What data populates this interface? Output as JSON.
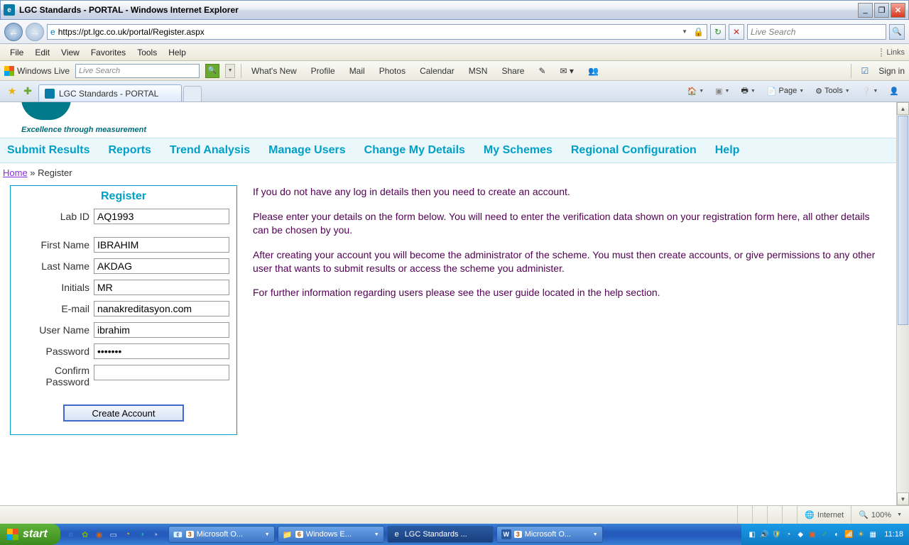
{
  "window": {
    "title": "LGC Standards - PORTAL - Windows Internet Explorer"
  },
  "address": {
    "url": "https://pt.lgc.co.uk/portal/Register.aspx",
    "search_placeholder": "Live Search"
  },
  "menubar": {
    "file": "File",
    "edit": "Edit",
    "view": "View",
    "favorites": "Favorites",
    "tools": "Tools",
    "help": "Help",
    "links": "Links"
  },
  "livebar": {
    "brand": "Windows Live",
    "search_placeholder": "Live Search",
    "links": {
      "whatsnew": "What's New",
      "profile": "Profile",
      "mail": "Mail",
      "photos": "Photos",
      "calendar": "Calendar",
      "msn": "MSN",
      "share": "Share"
    },
    "signin": "Sign in"
  },
  "tab": {
    "title": "LGC Standards - PORTAL"
  },
  "cmdbar": {
    "page": "Page",
    "tools": "Tools"
  },
  "page": {
    "tagline": "Excellence through measurement",
    "nav": {
      "submit": "Submit Results",
      "reports": "Reports",
      "trend": "Trend Analysis",
      "manage": "Manage Users",
      "change": "Change My Details",
      "schemes": "My Schemes",
      "regional": "Regional Configuration",
      "help": "Help"
    },
    "breadcrumb": {
      "home": "Home",
      "sep": " » ",
      "current": "Register"
    },
    "register": {
      "title": "Register",
      "labels": {
        "labid": "Lab ID",
        "first": "First Name",
        "last": "Last Name",
        "initials": "Initials",
        "email": "E-mail",
        "user": "User Name",
        "pass": "Password",
        "confirm": "Confirm Password"
      },
      "values": {
        "labid": "AQ1993",
        "first": "IBRAHIM",
        "last": "AKDAG",
        "initials": "MR",
        "email": "nanakreditasyon.com",
        "user": "ibrahim",
        "pass": "•••••••",
        "confirm": ""
      },
      "button": "Create Account"
    },
    "instructions": {
      "p1": "If you do not have any log in details then you need to create an account.",
      "p2": "Please enter your details on the form below. You will need to enter the verification data shown on your registration form here, all other details can be chosen by you.",
      "p3": "After creating your account you will become the administrator of the scheme. You must then create accounts, or give permissions to any other user that wants to submit results or access the scheme you administer.",
      "p4": "For further information regarding users please see the user guide located in the help section."
    }
  },
  "statusbar": {
    "zone": "Internet",
    "zoom": "100%"
  },
  "taskbar": {
    "start": "start",
    "tasks": [
      {
        "badge": "3",
        "label": "Microsoft O..."
      },
      {
        "badge": "6",
        "label": "Windows E..."
      },
      {
        "badge": "",
        "label": "LGC Standards ..."
      },
      {
        "badge": "3",
        "label": "Microsoft O..."
      }
    ],
    "clock": "11:18"
  }
}
